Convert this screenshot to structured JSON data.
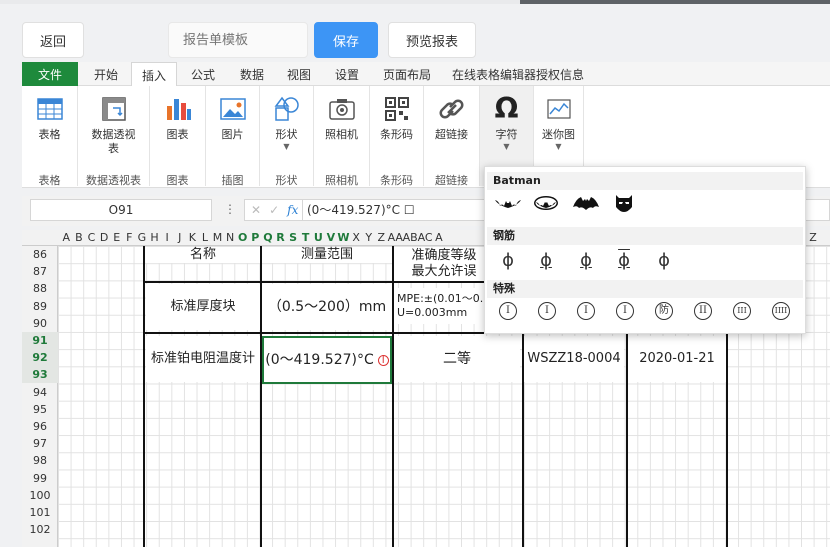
{
  "toolbar": {
    "back_label": "返回",
    "template_placeholder": "报告单模板",
    "save_label": "保存",
    "preview_label": "预览报表"
  },
  "tabs": [
    "文件",
    "开始",
    "插入",
    "公式",
    "数据",
    "视图",
    "设置",
    "页面布局",
    "在线表格编辑器授权信息"
  ],
  "active_tab": "插入",
  "ribbon": {
    "groups": [
      {
        "label": "表格",
        "caption": "表格",
        "icon": "table-icon"
      },
      {
        "label": "数据透视\n表",
        "caption": "数据透视表",
        "icon": "pivot-table-icon"
      },
      {
        "label": "图表",
        "caption": "图表",
        "icon": "chart-icon"
      },
      {
        "label": "图片",
        "caption": "插图",
        "icon": "picture-icon"
      },
      {
        "label": "形状",
        "caption": "形状",
        "icon": "shape-icon"
      },
      {
        "label": "照相机",
        "caption": "照相机",
        "icon": "camera-icon"
      },
      {
        "label": "条形码",
        "caption": "条形码",
        "icon": "barcode-icon"
      },
      {
        "label": "超链接",
        "caption": "超链接",
        "icon": "hyperlink-icon"
      },
      {
        "label": "字符",
        "caption": "",
        "icon": "omega-icon"
      },
      {
        "label": "迷你图",
        "caption": "",
        "icon": "sparkline-icon"
      }
    ]
  },
  "formula_bar": {
    "name_box": "O91",
    "fx": "fx",
    "formula": "(0～419.527)°C ☐"
  },
  "columns": [
    "A",
    "B",
    "C",
    "D",
    "E",
    "F",
    "G",
    "H",
    "I",
    "J",
    "K",
    "L",
    "M",
    "N",
    "O",
    "P",
    "Q",
    "R",
    "S",
    "T",
    "U",
    "V",
    "W",
    "X",
    "Y",
    "Z",
    "AA",
    "AB",
    "AC",
    "A"
  ],
  "selected_columns": [
    "O",
    "P",
    "Q",
    "R",
    "S",
    "T",
    "U",
    "V",
    "W"
  ],
  "column_tail": "Z",
  "rows": [
    "86",
    "87",
    "88",
    "89",
    "90",
    "91",
    "92",
    "93",
    "94",
    "95",
    "96",
    "97",
    "98",
    "99",
    "100",
    "101",
    "102"
  ],
  "selected_rows": [
    "91",
    "92",
    "93"
  ],
  "cells": {
    "name_header": "名称",
    "range_header": "测量范围",
    "accuracy_header": "准确度等级\n最大允许误",
    "row1_name": "标准厚度块",
    "row1_range": "（0.5～200）mm",
    "row1_accuracy": "MPE:±(0.01～0.\nU=0.003mm",
    "row2_name": "标准铂电阻温度计",
    "row2_range": "(0～419.527)°C",
    "row2_accuracy": "二等",
    "row2_code": "WSZZ18-0004",
    "row2_date": "2020-01-21"
  },
  "popup": {
    "sections": [
      "Batman",
      "钢筋",
      "特殊"
    ],
    "rebar_symbols": [
      "ϕ",
      "ϕ",
      "ϕ",
      "ϕ",
      "ϕ"
    ],
    "special_symbols": [
      "I",
      "I",
      "I",
      "I",
      "防",
      "II",
      "III",
      "IIII"
    ]
  },
  "colors": {
    "file_tab": "#1e8a3c",
    "primary": "#3d95f5",
    "selection": "#1f7a3a"
  }
}
